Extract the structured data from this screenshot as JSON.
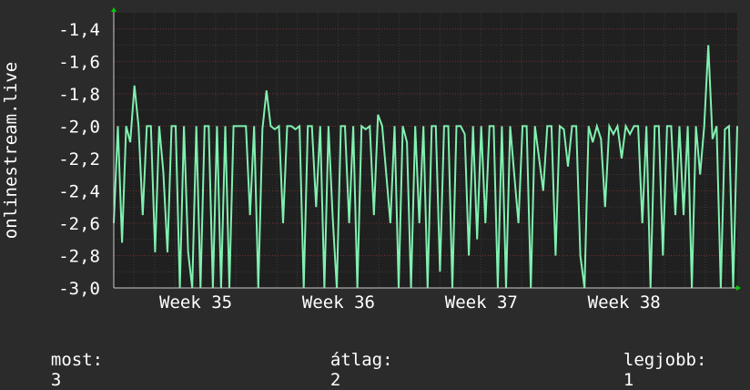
{
  "chart_data": {
    "type": "line",
    "ylabel": "onlinestream.live",
    "ylim": [
      -3.0,
      -1.3
    ],
    "yticks": [
      -3.0,
      -2.8,
      -2.6,
      -2.4,
      -2.2,
      -2.0,
      -1.8,
      -1.6,
      -1.4
    ],
    "ytick_labels": [
      "-3,0",
      "-2,8",
      "-2,6",
      "-2,4",
      "-2,2",
      "-2,0",
      "-1,8",
      "-1,6",
      "-1,4"
    ],
    "x_tick_labels": [
      "Week 35",
      "Week 36",
      "Week 37",
      "Week 38"
    ],
    "grid": true,
    "series": [
      {
        "color": "#80f0b0",
        "values": [
          -2.6,
          -2.0,
          -2.72,
          -2.0,
          -2.1,
          -1.75,
          -2.0,
          -2.55,
          -2.0,
          -2.0,
          -2.78,
          -2.0,
          -2.28,
          -2.78,
          -2.0,
          -2.0,
          -3.0,
          -2.0,
          -2.78,
          -3.0,
          -2.0,
          -3.0,
          -2.0,
          -2.0,
          -3.0,
          -2.0,
          -3.0,
          -2.0,
          -3.0,
          -2.0,
          -2.0,
          -2.0,
          -2.0,
          -2.55,
          -2.0,
          -3.0,
          -2.02,
          -1.78,
          -2.0,
          -2.02,
          -2.0,
          -2.6,
          -2.0,
          -2.0,
          -2.02,
          -2.0,
          -3.0,
          -2.0,
          -2.0,
          -2.5,
          -2.0,
          -3.0,
          -2.0,
          -2.55,
          -3.0,
          -2.0,
          -2.0,
          -2.6,
          -2.0,
          -3.0,
          -2.0,
          -2.02,
          -2.0,
          -2.55,
          -1.93,
          -2.0,
          -2.3,
          -2.6,
          -2.0,
          -3.0,
          -2.0,
          -2.1,
          -3.0,
          -2.0,
          -2.6,
          -2.0,
          -3.0,
          -2.0,
          -2.0,
          -2.9,
          -2.0,
          -2.0,
          -3.0,
          -2.0,
          -2.0,
          -2.05,
          -2.8,
          -2.0,
          -2.7,
          -2.0,
          -2.6,
          -2.0,
          -2.0,
          -3.0,
          -2.0,
          -3.0,
          -2.0,
          -2.3,
          -2.6,
          -2.0,
          -2.0,
          -3.0,
          -2.0,
          -2.2,
          -2.4,
          -2.0,
          -2.0,
          -2.8,
          -2.0,
          -2.02,
          -2.25,
          -2.0,
          -2.0,
          -2.8,
          -3.0,
          -2.0,
          -2.1,
          -2.0,
          -2.08,
          -2.5,
          -2.0,
          -2.05,
          -2.0,
          -2.2,
          -2.0,
          -2.05,
          -2.0,
          -2.0,
          -2.6,
          -2.0,
          -3.0,
          -2.0,
          -2.0,
          -2.8,
          -2.0,
          -2.0,
          -2.55,
          -2.0,
          -2.55,
          -2.0,
          -3.0,
          -2.0,
          -2.3,
          -2.0,
          -1.5,
          -2.08,
          -2.0,
          -3.0,
          -2.02,
          -2.0,
          -3.0,
          -2.0
        ]
      }
    ]
  },
  "legend": {
    "now_label": "most:",
    "now_value": "3",
    "avg_label": "átlag:",
    "avg_value": "2",
    "best_label": "legjobb:",
    "best_value": "1"
  }
}
